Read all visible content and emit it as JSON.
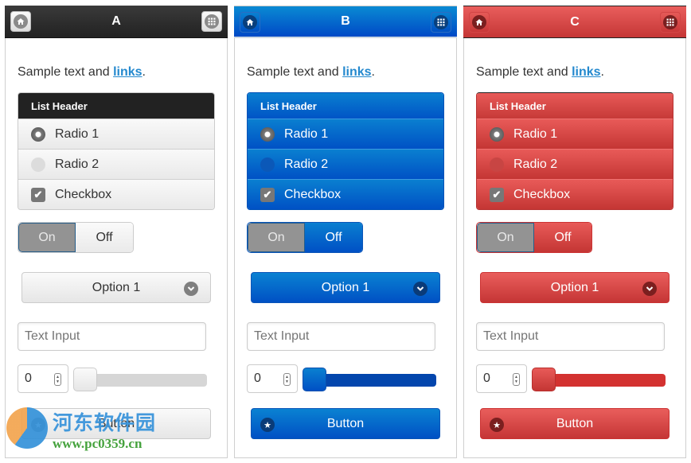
{
  "panels": [
    {
      "theme": "gray",
      "title": "A",
      "home_icon": "home-icon",
      "grid_icon": "grid-icon",
      "sample_text": "Sample text and ",
      "link_text": "links",
      "sample_end": ".",
      "list_header": "List Header",
      "radio1": "Radio 1",
      "radio2": "Radio 2",
      "radio1_checked": true,
      "checkbox": "Checkbox",
      "checkbox_checked": true,
      "toggle_on": "On",
      "toggle_off": "Off",
      "toggle_state": "on",
      "select_value": "Option 1",
      "text_input_placeholder": "Text Input",
      "number_value": "0",
      "slider_value": 0,
      "button_label": "Button"
    },
    {
      "theme": "blue",
      "title": "B",
      "home_icon": "home-icon",
      "grid_icon": "grid-icon",
      "sample_text": "Sample text and ",
      "link_text": "links",
      "sample_end": ".",
      "list_header": "List Header",
      "radio1": "Radio 1",
      "radio2": "Radio 2",
      "radio1_checked": true,
      "checkbox": "Checkbox",
      "checkbox_checked": true,
      "toggle_on": "On",
      "toggle_off": "Off",
      "toggle_state": "on",
      "select_value": "Option 1",
      "text_input_placeholder": "Text Input",
      "number_value": "0",
      "slider_value": 0,
      "button_label": "Button"
    },
    {
      "theme": "red",
      "title": "C",
      "home_icon": "home-icon",
      "grid_icon": "grid-icon",
      "sample_text": "Sample text and ",
      "link_text": "links",
      "sample_end": ".",
      "list_header": "List Header",
      "radio1": "Radio 1",
      "radio2": "Radio 2",
      "radio1_checked": true,
      "checkbox": "Checkbox",
      "checkbox_checked": true,
      "toggle_on": "On",
      "toggle_off": "Off",
      "toggle_state": "on",
      "select_value": "Option 1",
      "text_input_placeholder": "Text Input",
      "number_value": "0",
      "slider_value": 0,
      "button_label": "Button"
    }
  ],
  "theme_colors": {
    "gray": "#222222",
    "blue": "#0057c8",
    "red": "#d43b39",
    "link": "#2489ce"
  },
  "watermark": {
    "name": "河东软件园",
    "url": "www.pc0359.cn"
  },
  "glyphs": {
    "check": "✔",
    "chevron": "⌄",
    "star": "★",
    "spin_up": "▲",
    "spin_down": "▼"
  }
}
